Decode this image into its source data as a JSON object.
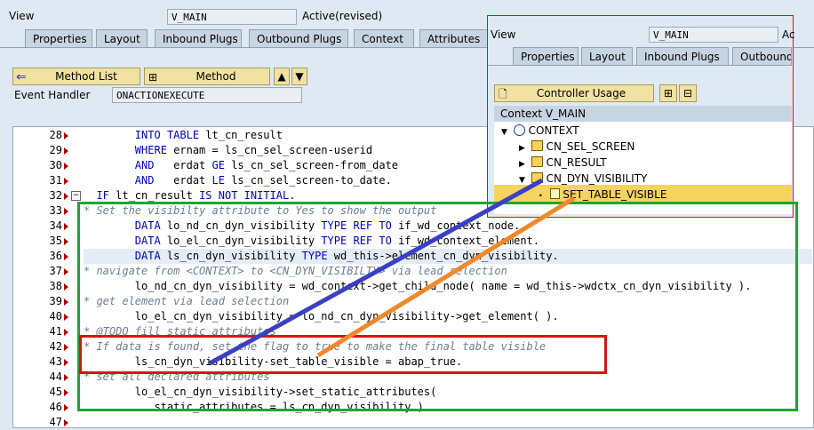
{
  "header": {
    "view_label": "View",
    "view_value": "V_MAIN",
    "status": "Active(revised)"
  },
  "tabs": [
    "Properties",
    "Layout",
    "Inbound Plugs",
    "Outbound Plugs",
    "Context",
    "Attributes"
  ],
  "toolbar": {
    "method_list": "Method List",
    "method": "Method",
    "event_handler_label": "Event Handler",
    "event_handler_value": "ONACTIONEXECUTE"
  },
  "code_lines": [
    {
      "n": "28",
      "t": "        INTO TABLE lt_cn_result"
    },
    {
      "n": "29",
      "t": "        WHERE ernam = ls_cn_sel_screen-userid"
    },
    {
      "n": "30",
      "t": "        AND   erdat GE ls_cn_sel_screen-from_date"
    },
    {
      "n": "31",
      "t": "        AND   erdat LE ls_cn_sel_screen-to_date."
    },
    {
      "n": "32",
      "t": "  IF lt_cn_result IS NOT INITIAL."
    },
    {
      "n": "33",
      "t": "* Set the visibilty attribute to Yes to show the output"
    },
    {
      "n": "34",
      "t": "        DATA lo_nd_cn_dyn_visibility TYPE REF TO if_wd_context_node."
    },
    {
      "n": "35",
      "t": "        DATA lo_el_cn_dyn_visibility TYPE REF TO if_wd_context_element."
    },
    {
      "n": "36",
      "t": "        DATA ls_cn_dyn_visibility TYPE wd_this->element_cn_dyn_visibility."
    },
    {
      "n": "37",
      "t": "* navigate from <CONTEXT> to <CN_DYN_VISIBILTY> via lead selection"
    },
    {
      "n": "38",
      "t": "        lo_nd_cn_dyn_visibility = wd_context->get_child_node( name = wd_this->wdctx_cn_dyn_visibility )."
    },
    {
      "n": "39",
      "t": "* get element via lead selection"
    },
    {
      "n": "40",
      "t": "        lo_el_cn_dyn_visibility = lo_nd_cn_dyn_visibility->get_element( )."
    },
    {
      "n": "41",
      "t": "* @TODO fill static attributes"
    },
    {
      "n": "42",
      "t": "* If data is found, set the flag to true to make the final table visible"
    },
    {
      "n": "43",
      "t": "        ls_cn_dyn_visibility-set_table_visible = abap_true."
    },
    {
      "n": "44",
      "t": "* set all declared attributes"
    },
    {
      "n": "45",
      "t": "        lo_el_cn_dyn_visibility->set_static_attributes("
    },
    {
      "n": "46",
      "t": "           static_attributes = ls_cn_dyn_visibility )."
    },
    {
      "n": "47",
      "t": ""
    }
  ],
  "overlay": {
    "view_label": "View",
    "view_value": "V_MAIN",
    "status_partial": "Ac",
    "tabs": [
      "Properties",
      "Layout",
      "Inbound Plugs",
      "Outbound"
    ],
    "controller_usage": "Controller Usage",
    "context_title": "Context V_MAIN",
    "tree": [
      "CONTEXT",
      "CN_SEL_SCREEN",
      "CN_RESULT",
      "CN_DYN_VISIBILITY",
      "SET_TABLE_VISIBLE"
    ]
  },
  "colors": {
    "green_box": "#1fa531",
    "red_box": "#e01010",
    "blue_line": "#3a3fc4",
    "orange_line": "#f0892a"
  }
}
